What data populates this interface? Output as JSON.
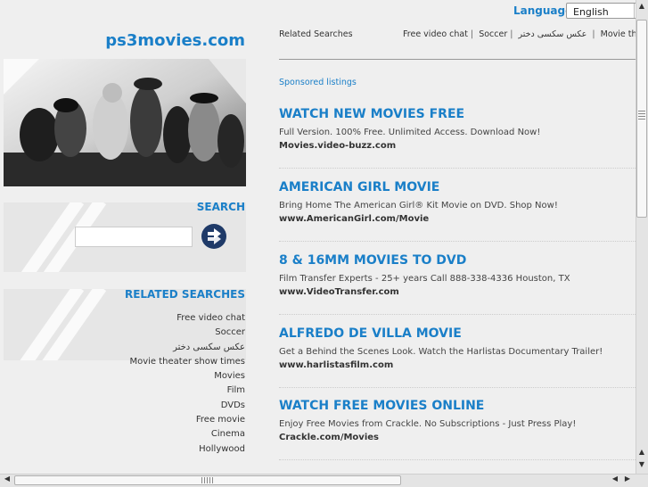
{
  "language": {
    "label": "Language:",
    "selected": "English",
    "arrow_icon": "chevron-down-icon"
  },
  "site": {
    "name": "ps3movies.com"
  },
  "search": {
    "heading": "SEARCH",
    "button_icon": "arrow-right-icon"
  },
  "related": {
    "heading": "RELATED SEARCHES",
    "items": [
      "Free video chat",
      "Soccer",
      "عکس سکسی دختر",
      "Movie theater show times",
      "Movies",
      "Film",
      "DVDs",
      "Free movie",
      "Cinema",
      "Hollywood"
    ]
  },
  "top": {
    "related_label": "Related Searches",
    "links": [
      "Free video chat",
      "Soccer",
      "عکس سکسی دختر",
      "Movie theater"
    ]
  },
  "sponsored": "Sponsored listings",
  "ads": [
    {
      "title": "WATCH NEW MOVIES FREE",
      "desc": "Full Version. 100% Free. Unlimited Access. Download Now!",
      "url": "Movies.video-buzz.com"
    },
    {
      "title": "AMERICAN GIRL MOVIE",
      "desc": "Bring Home The American Girl® Kit Movie on DVD. Shop Now!",
      "url": "www.AmericanGirl.com/Movie"
    },
    {
      "title": "8 & 16MM MOVIES TO DVD",
      "desc": "Film Transfer Experts - 25+ years Call 888-338-4336 Houston, TX",
      "url": "www.VideoTransfer.com"
    },
    {
      "title": "ALFREDO DE VILLA MOVIE",
      "desc": "Get a Behind the Scenes Look. Watch the Harlistas Documentary Trailer!",
      "url": "www.harlistasfilm.com"
    },
    {
      "title": "WATCH FREE MOVIES ONLINE",
      "desc": "Enjoy Free Movies from Crackle. No Subscriptions - Just Press Play!",
      "url": "Crackle.com/Movies"
    }
  ],
  "colors": {
    "accent": "#1a7fc8",
    "background": "#efefef",
    "text": "#333333"
  }
}
